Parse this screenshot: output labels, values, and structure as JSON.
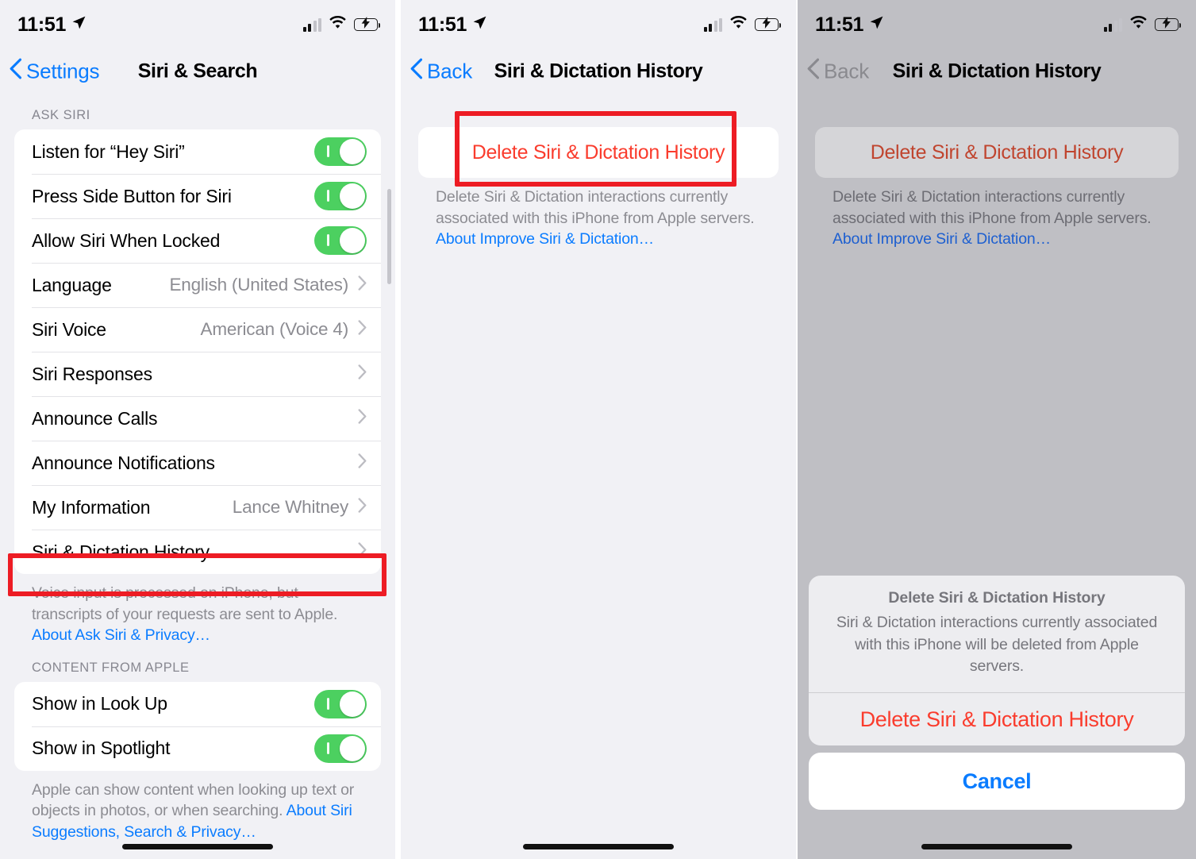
{
  "status_bar": {
    "time": "11:51",
    "location_icon": "location-arrow-icon",
    "cellular_icon": "cellular-bars-icon",
    "wifi_icon": "wifi-icon",
    "battery_icon": "battery-charging-icon"
  },
  "panel1": {
    "nav": {
      "back_label": "Settings",
      "title": "Siri & Search"
    },
    "section1": {
      "header": "ASK SIRI",
      "rows": [
        {
          "label": "Listen for “Hey Siri”",
          "type": "toggle",
          "value": "on"
        },
        {
          "label": "Press Side Button for Siri",
          "type": "toggle",
          "value": "on"
        },
        {
          "label": "Allow Siri When Locked",
          "type": "toggle",
          "value": "on"
        },
        {
          "label": "Language",
          "type": "link",
          "value": "English (United States)"
        },
        {
          "label": "Siri Voice",
          "type": "link",
          "value": "American (Voice 4)"
        },
        {
          "label": "Siri Responses",
          "type": "link",
          "value": ""
        },
        {
          "label": "Announce Calls",
          "type": "link",
          "value": ""
        },
        {
          "label": "Announce Notifications",
          "type": "link",
          "value": ""
        },
        {
          "label": "My Information",
          "type": "link",
          "value": "Lance Whitney"
        },
        {
          "label": "Siri & Dictation History",
          "type": "link",
          "value": ""
        }
      ],
      "footnote_text": "Voice input is processed on iPhone, but transcripts of your requests are sent to Apple. ",
      "footnote_link": "About Ask Siri & Privacy…"
    },
    "section2": {
      "header": "CONTENT FROM APPLE",
      "rows": [
        {
          "label": "Show in Look Up",
          "type": "toggle",
          "value": "on"
        },
        {
          "label": "Show in Spotlight",
          "type": "toggle",
          "value": "on"
        }
      ],
      "footnote_text": "Apple can show content when looking up text or objects in photos, or when searching. ",
      "footnote_link": "About Siri Suggestions, Search & Privacy…"
    }
  },
  "panel2": {
    "nav": {
      "back_label": "Back",
      "title": "Siri & Dictation History"
    },
    "delete_button_label": "Delete Siri & Dictation History",
    "footnote_text": "Delete Siri & Dictation interactions currently associated with this iPhone from Apple servers. ",
    "footnote_link": "About Improve Siri & Dictation…"
  },
  "panel3": {
    "nav": {
      "back_label": "Back",
      "title": "Siri & Dictation History"
    },
    "delete_button_label": "Delete Siri & Dictation History",
    "footnote_text": "Delete Siri & Dictation interactions currently associated with this iPhone from Apple servers. ",
    "footnote_link": "About Improve Siri & Dictation…",
    "action_sheet": {
      "title": "Delete Siri & Dictation History",
      "message": "Siri & Dictation interactions currently associated with this iPhone will be deleted from Apple servers.",
      "destructive_label": "Delete Siri & Dictation History",
      "cancel_label": "Cancel"
    }
  },
  "annotations": {
    "highlight_color": "#ed1c24",
    "box1_target": "Siri & Dictation History",
    "box2_target": "Delete Siri & Dictation History"
  },
  "colors": {
    "tint_blue": "#0a7cff",
    "destructive_red": "#fa3c2d",
    "toggle_green": "#4cd060",
    "page_bg": "#f1f1f5",
    "dim_overlay": "#bfbfc4"
  }
}
